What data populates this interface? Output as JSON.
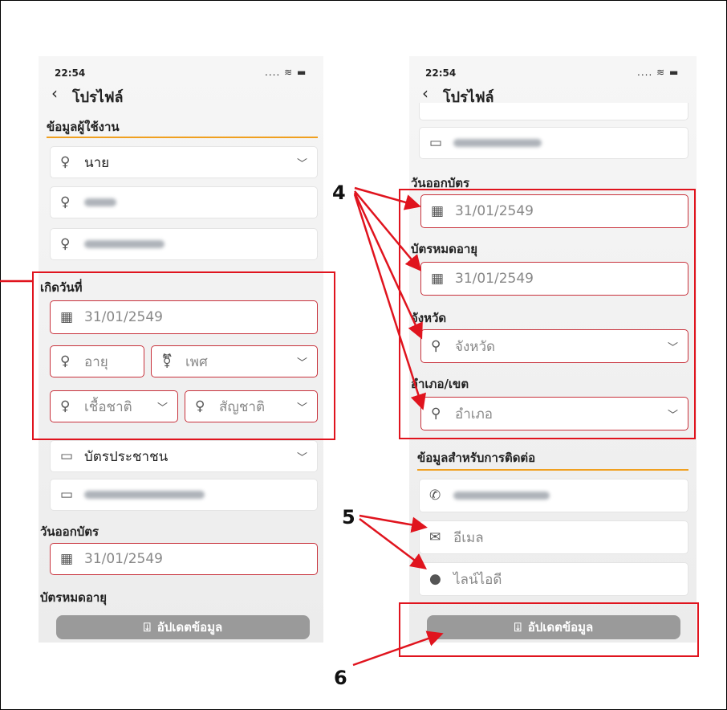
{
  "time": "22:54",
  "status_icons": ".... ≋ ▬",
  "screen_title": "โปรไฟล์",
  "left": {
    "section_user": "ข้อมูลผู้ใช้งาน",
    "prefix_value": "นาย",
    "birth_label": "เกิดวันที่",
    "birth_date": "31/01/2549",
    "age_placeholder": "อายุ",
    "gender_placeholder": "เพศ",
    "race_placeholder": "เชื้อชาติ",
    "nationality_placeholder": "สัญชาติ",
    "id_type_value": "บัตรประชาชน",
    "issue_label": "วันออกบัตร",
    "issue_date": "31/01/2549",
    "expire_label": "บัตรหมดอายุ",
    "update_button": "อัปเดตข้อมูล"
  },
  "right": {
    "issue_label": "วันออกบัตร",
    "issue_date": "31/01/2549",
    "expire_label": "บัตรหมดอายุ",
    "expire_date": "31/01/2549",
    "province_label": "จังหวัด",
    "province_placeholder": "จังหวัด",
    "district_label": "อำเภอ/เขต",
    "district_placeholder": "อำเภอ",
    "contact_section": "ข้อมูลสำหรับการติดต่อ",
    "email_placeholder": "อีเมล",
    "line_placeholder": "ไลน์ไอดี",
    "update_button": "อัปเดตข้อมูล"
  },
  "annotations": {
    "n4": "4",
    "n5": "5",
    "n6": "6"
  },
  "colors": {
    "accent": "#f0a020",
    "field_border": "#c8323c",
    "annotation": "#e0141e",
    "button": "#9a9a9a"
  }
}
